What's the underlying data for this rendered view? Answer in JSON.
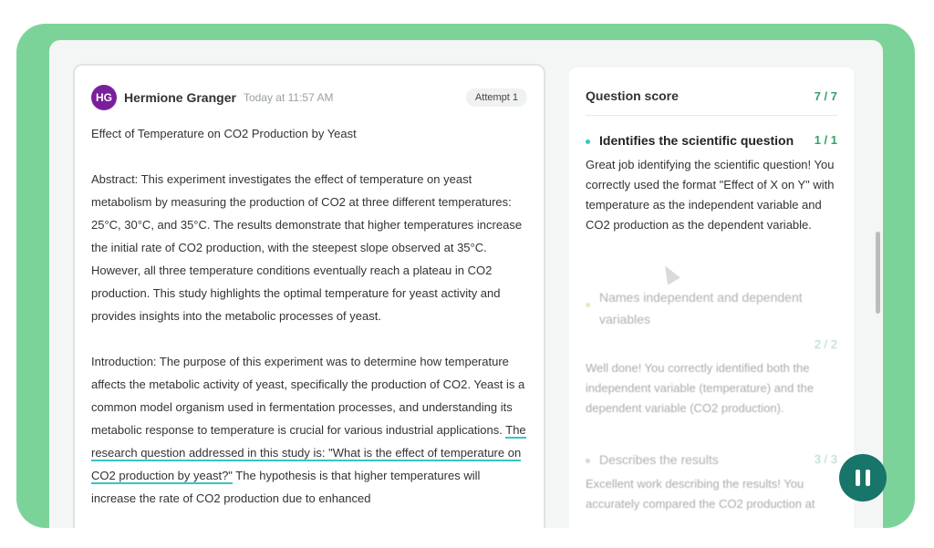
{
  "submission": {
    "avatar_initials": "HG",
    "author": "Hermione Granger",
    "timestamp": "Today at 11:57 AM",
    "attempt": "Attempt 1",
    "title": "Effect of Temperature on CO2 Production by Yeast",
    "abstract": "Abstract: This experiment investigates the effect of temperature on yeast metabolism by measuring the production of CO2 at three different temperatures: 25°C, 30°C, and 35°C. The results demonstrate that higher temperatures increase the initial rate of CO2 production, with the steepest slope observed at 35°C. However, all three temperature conditions eventually reach a plateau in CO2 production. This study highlights the optimal temperature for yeast activity and provides insights into the metabolic processes of yeast.",
    "intro_before": "Introduction: The purpose of this experiment was to determine how temperature affects the metabolic activity of yeast, specifically the production of CO2. Yeast is a common model organism used in fermentation processes, and understanding its metabolic response to temperature is crucial for various industrial applications. ",
    "intro_highlight": "The research question addressed in this study is: \"What is the effect of temperature on CO2 production by yeast?\"",
    "intro_after": " The hypothesis is that higher temperatures will increase the rate of CO2 production due to enhanced"
  },
  "scores": {
    "title": "Question score",
    "total": "7 / 7",
    "criteria": [
      {
        "name": "Identifies the scientific question",
        "score": "1 / 1",
        "feedback": "Great job identifying the scientific question! You correctly used the format \"Effect of X on Y\" with temperature as the independent variable and CO2 production as the dependent variable."
      },
      {
        "name": "Names independent and dependent variables",
        "score": "2 / 2",
        "feedback": "Well done! You correctly identified both the independent variable (temperature) and the dependent variable (CO2 production)."
      },
      {
        "name": "Describes the results",
        "score": "3 / 3",
        "feedback": "Excellent work describing the results! You accurately compared the CO2 production at"
      }
    ]
  },
  "colors": {
    "frame": "#7cd39a",
    "avatar": "#7a1f9c",
    "score_green": "#2ea36b",
    "highlight": "#34c6c6",
    "pause_button": "#17756a"
  },
  "icons": [
    "pause-icon",
    "cursor-icon"
  ]
}
